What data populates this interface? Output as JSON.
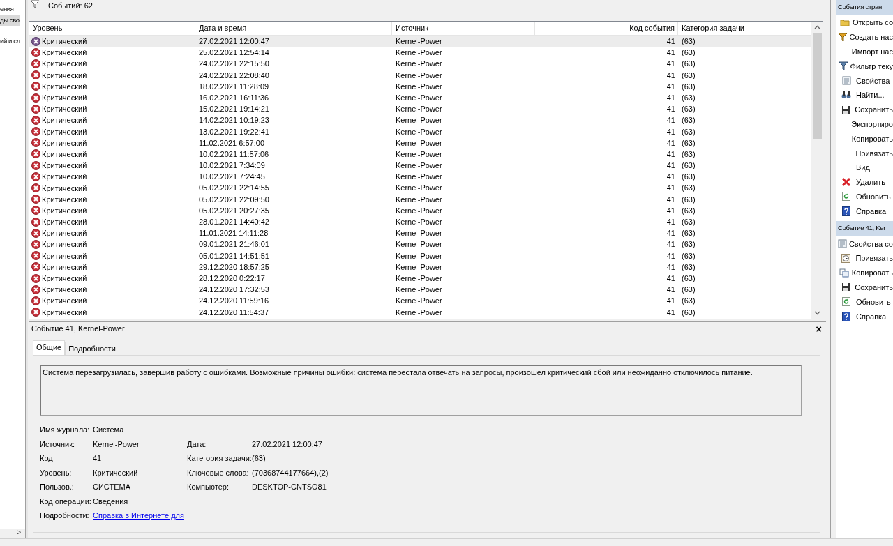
{
  "sidebar": {
    "items": [
      {
        "label": "ения",
        "selected": false
      },
      {
        "label": "ды сво",
        "selected": true
      },
      {
        "label": "ий и сл",
        "selected": false
      }
    ],
    "scroll_right": ">"
  },
  "summary": {
    "label": "Событий: 62"
  },
  "events": {
    "columns": [
      "Уровень",
      "Дата и время",
      "Источник",
      "Код события",
      "Категория задачи"
    ],
    "rows": [
      {
        "level": "Критический",
        "date": "27.02.2021 12:00:47",
        "source": "Kernel-Power",
        "code": "41",
        "category": "(63)",
        "selected": true
      },
      {
        "level": "Критический",
        "date": "25.02.2021 12:54:14",
        "source": "Kernel-Power",
        "code": "41",
        "category": "(63)",
        "selected": false
      },
      {
        "level": "Критический",
        "date": "24.02.2021 22:15:50",
        "source": "Kernel-Power",
        "code": "41",
        "category": "(63)",
        "selected": false
      },
      {
        "level": "Критический",
        "date": "24.02.2021 22:08:40",
        "source": "Kernel-Power",
        "code": "41",
        "category": "(63)",
        "selected": false
      },
      {
        "level": "Критический",
        "date": "18.02.2021 11:28:09",
        "source": "Kernel-Power",
        "code": "41",
        "category": "(63)",
        "selected": false
      },
      {
        "level": "Критический",
        "date": "16.02.2021 16:11:36",
        "source": "Kernel-Power",
        "code": "41",
        "category": "(63)",
        "selected": false
      },
      {
        "level": "Критический",
        "date": "15.02.2021 19:14:21",
        "source": "Kernel-Power",
        "code": "41",
        "category": "(63)",
        "selected": false
      },
      {
        "level": "Критический",
        "date": "14.02.2021 10:19:23",
        "source": "Kernel-Power",
        "code": "41",
        "category": "(63)",
        "selected": false
      },
      {
        "level": "Критический",
        "date": "13.02.2021 19:22:41",
        "source": "Kernel-Power",
        "code": "41",
        "category": "(63)",
        "selected": false
      },
      {
        "level": "Критический",
        "date": "11.02.2021 6:57:00",
        "source": "Kernel-Power",
        "code": "41",
        "category": "(63)",
        "selected": false
      },
      {
        "level": "Критический",
        "date": "10.02.2021 11:57:06",
        "source": "Kernel-Power",
        "code": "41",
        "category": "(63)",
        "selected": false
      },
      {
        "level": "Критический",
        "date": "10.02.2021 7:34:09",
        "source": "Kernel-Power",
        "code": "41",
        "category": "(63)",
        "selected": false
      },
      {
        "level": "Критический",
        "date": "10.02.2021 7:24:45",
        "source": "Kernel-Power",
        "code": "41",
        "category": "(63)",
        "selected": false
      },
      {
        "level": "Критический",
        "date": "05.02.2021 22:14:55",
        "source": "Kernel-Power",
        "code": "41",
        "category": "(63)",
        "selected": false
      },
      {
        "level": "Критический",
        "date": "05.02.2021 22:09:50",
        "source": "Kernel-Power",
        "code": "41",
        "category": "(63)",
        "selected": false
      },
      {
        "level": "Критический",
        "date": "05.02.2021 20:27:35",
        "source": "Kernel-Power",
        "code": "41",
        "category": "(63)",
        "selected": false
      },
      {
        "level": "Критический",
        "date": "28.01.2021 14:40:42",
        "source": "Kernel-Power",
        "code": "41",
        "category": "(63)",
        "selected": false
      },
      {
        "level": "Критический",
        "date": "11.01.2021 14:11:28",
        "source": "Kernel-Power",
        "code": "41",
        "category": "(63)",
        "selected": false
      },
      {
        "level": "Критический",
        "date": "09.01.2021 21:46:01",
        "source": "Kernel-Power",
        "code": "41",
        "category": "(63)",
        "selected": false
      },
      {
        "level": "Критический",
        "date": "05.01.2021 14:51:51",
        "source": "Kernel-Power",
        "code": "41",
        "category": "(63)",
        "selected": false
      },
      {
        "level": "Критический",
        "date": "29.12.2020 18:57:25",
        "source": "Kernel-Power",
        "code": "41",
        "category": "(63)",
        "selected": false
      },
      {
        "level": "Критический",
        "date": "28.12.2020 0:22:17",
        "source": "Kernel-Power",
        "code": "41",
        "category": "(63)",
        "selected": false
      },
      {
        "level": "Критический",
        "date": "24.12.2020 17:32:53",
        "source": "Kernel-Power",
        "code": "41",
        "category": "(63)",
        "selected": false
      },
      {
        "level": "Критический",
        "date": "24.12.2020 11:59:16",
        "source": "Kernel-Power",
        "code": "41",
        "category": "(63)",
        "selected": false
      },
      {
        "level": "Критический",
        "date": "24.12.2020 11:54:37",
        "source": "Kernel-Power",
        "code": "41",
        "category": "(63)",
        "selected": false
      }
    ]
  },
  "detail": {
    "title": "Событие 41, Kernel-Power",
    "close": "×",
    "tabs": [
      {
        "label": "Общие",
        "selected": true
      },
      {
        "label": "Подробности",
        "selected": false
      }
    ],
    "description": "Система перезагрузилась, завершив работу с ошибками. Возможные причины ошибки: система перестала отвечать на запросы, произошел критический сбой или неожиданно отключилось питание.",
    "rows": [
      {
        "cells": [
          {
            "label": "Имя журнала:",
            "value": "Система",
            "kind": "text"
          }
        ]
      },
      {
        "cells": [
          {
            "label": "Источник:",
            "value": "Kernel-Power",
            "kind": "text"
          },
          {
            "label": "Дата:",
            "value": "27.02.2021 12:00:47",
            "kind": "text"
          }
        ]
      },
      {
        "cells": [
          {
            "label": "Код",
            "value": "41",
            "kind": "text"
          },
          {
            "label": "Категория задачи:",
            "value": "(63)",
            "kind": "text"
          }
        ]
      },
      {
        "cells": [
          {
            "label": "Уровень:",
            "value": "Критический",
            "kind": "text"
          },
          {
            "label": "Ключевые слова:",
            "value": "(70368744177664),(2)",
            "kind": "text"
          }
        ]
      },
      {
        "cells": [
          {
            "label": "Пользов.:",
            "value": "СИСТЕМА",
            "kind": "text"
          },
          {
            "label": "Компьютер:",
            "value": "DESKTOP-CNTSO81",
            "kind": "text"
          }
        ]
      },
      {
        "cells": [
          {
            "label": "Код операции:",
            "value": "Сведения",
            "kind": "text"
          }
        ]
      },
      {
        "cells": [
          {
            "label": "Подробности:",
            "value": "Справка в Интернете для",
            "kind": "link"
          }
        ]
      }
    ]
  },
  "actions": [
    {
      "title": "События стран",
      "items": [
        {
          "label": "Открыть со"
        },
        {
          "label": "Создать нас"
        },
        {
          "label": "Импорт нас"
        },
        {
          "label": "Фильтр теку"
        },
        {
          "label": "Свойства"
        },
        {
          "label": "Найти..."
        },
        {
          "label": "Сохранить"
        },
        {
          "label": "Экспортиро"
        },
        {
          "label": "Копировать"
        },
        {
          "label": "Привязать"
        },
        {
          "label": "Вид"
        },
        {
          "label": "Удалить"
        },
        {
          "label": "Обновить"
        },
        {
          "label": "Справка"
        }
      ]
    },
    {
      "title": "Событие 41, Ker",
      "items": [
        {
          "label": "Свойства со"
        },
        {
          "label": "Привязать"
        },
        {
          "label": "Копировать"
        },
        {
          "label": "Сохранить"
        },
        {
          "label": "Обновить"
        },
        {
          "label": "Справка"
        }
      ]
    }
  ]
}
